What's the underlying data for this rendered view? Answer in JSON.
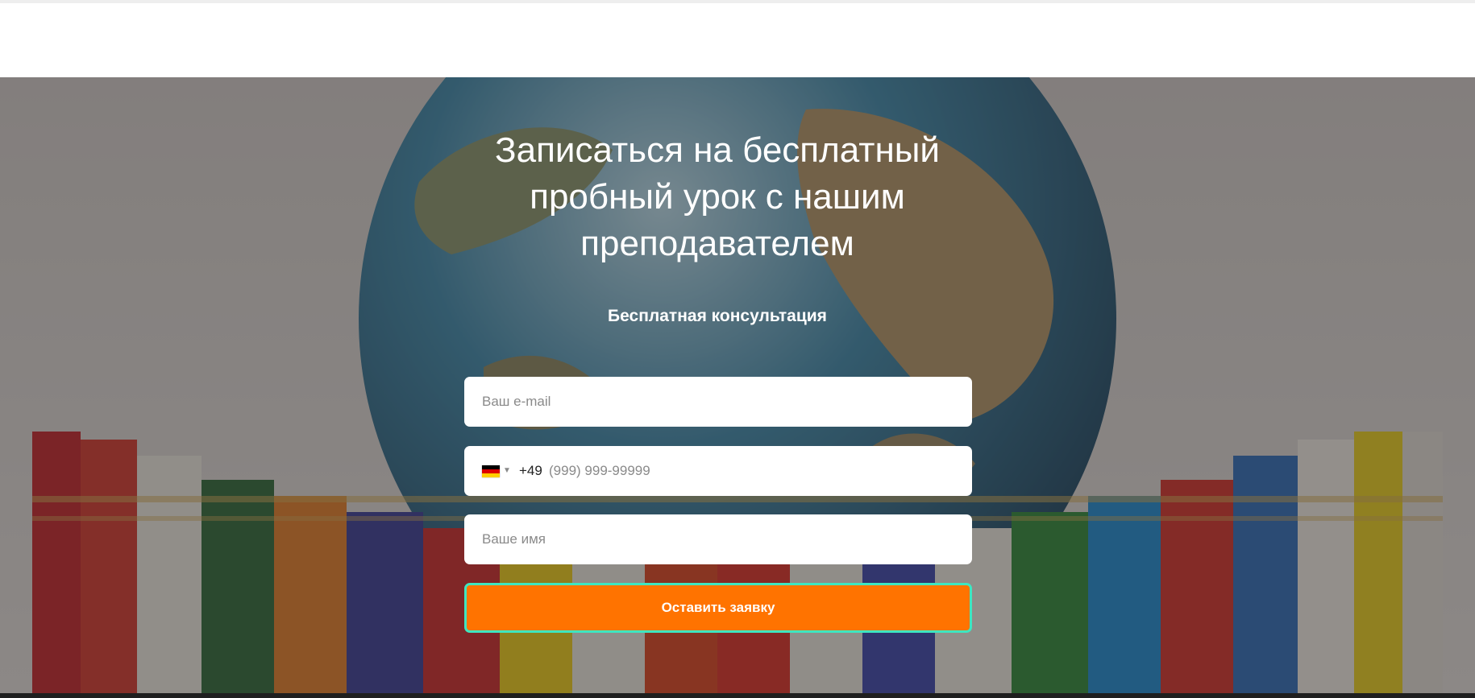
{
  "hero": {
    "title_line1": "Записаться на бесплатный",
    "title_line2": "пробный урок с нашим",
    "title_line3": "преподавателем",
    "subtitle": "Бесплатная консультация"
  },
  "form": {
    "email_placeholder": "Ваш e-mail",
    "phone_country": "DE",
    "phone_dial_code": "+49",
    "phone_placeholder": "(999) 999-99999",
    "name_placeholder": "Ваше имя",
    "submit_label": "Оставить заявку"
  },
  "colors": {
    "accent": "#ff7300",
    "button_border": "#3ee6c0"
  }
}
